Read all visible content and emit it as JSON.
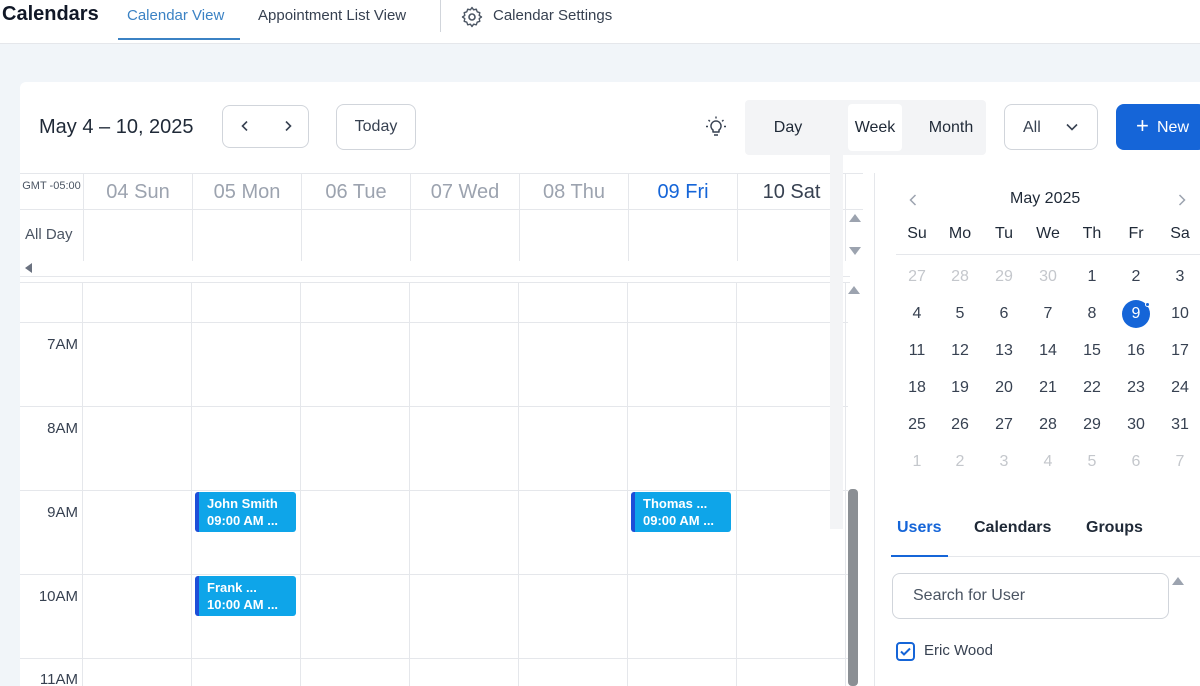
{
  "nav": {
    "title": "Calendars",
    "tabs": [
      {
        "label": "Calendar View"
      },
      {
        "label": "Appointment List View"
      },
      {
        "label": "Calendar Settings"
      }
    ]
  },
  "toolbar": {
    "range": "May 4 – 10, 2025",
    "today": "Today",
    "views": [
      "Day",
      "Week",
      "Month"
    ],
    "active_view": "Week",
    "filter": "All",
    "new_label": "New"
  },
  "grid": {
    "timezone": "GMT -05:00",
    "all_day_label": "All Day",
    "days": [
      "04 Sun",
      "05 Mon",
      "06 Tue",
      "07 Wed",
      "08 Thu",
      "09 Fri",
      "10 Sat"
    ],
    "today_index": 5,
    "hours": [
      "7AM",
      "8AM",
      "9AM",
      "10AM",
      "11AM"
    ],
    "events": [
      {
        "title": "John Smith",
        "time": "09:00 AM ..."
      },
      {
        "title": "Thomas ...",
        "time": "09:00 AM ..."
      },
      {
        "title": "Frank ...",
        "time": "10:00 AM ..."
      }
    ]
  },
  "mini_calendar": {
    "title": "May 2025",
    "weekdays": [
      "Su",
      "Mo",
      "Tu",
      "We",
      "Th",
      "Fr",
      "Sa"
    ],
    "weeks": [
      [
        "27",
        "28",
        "29",
        "30",
        "1",
        "2",
        "3"
      ],
      [
        "4",
        "5",
        "6",
        "7",
        "8",
        "9",
        "10"
      ],
      [
        "11",
        "12",
        "13",
        "14",
        "15",
        "16",
        "17"
      ],
      [
        "18",
        "19",
        "20",
        "21",
        "22",
        "23",
        "24"
      ],
      [
        "25",
        "26",
        "27",
        "28",
        "29",
        "30",
        "31"
      ],
      [
        "1",
        "2",
        "3",
        "4",
        "5",
        "6",
        "7"
      ]
    ],
    "selected": "9"
  },
  "panel": {
    "tabs": [
      "Users",
      "Calendars",
      "Groups"
    ],
    "active_tab": "Users",
    "search_placeholder": "Search for User",
    "users": [
      {
        "name": "Eric Wood",
        "checked": true
      }
    ]
  },
  "colors": {
    "accent": "#1565d8",
    "event_fill": "#0ea5e9",
    "event_border": "#1d4ed8"
  }
}
